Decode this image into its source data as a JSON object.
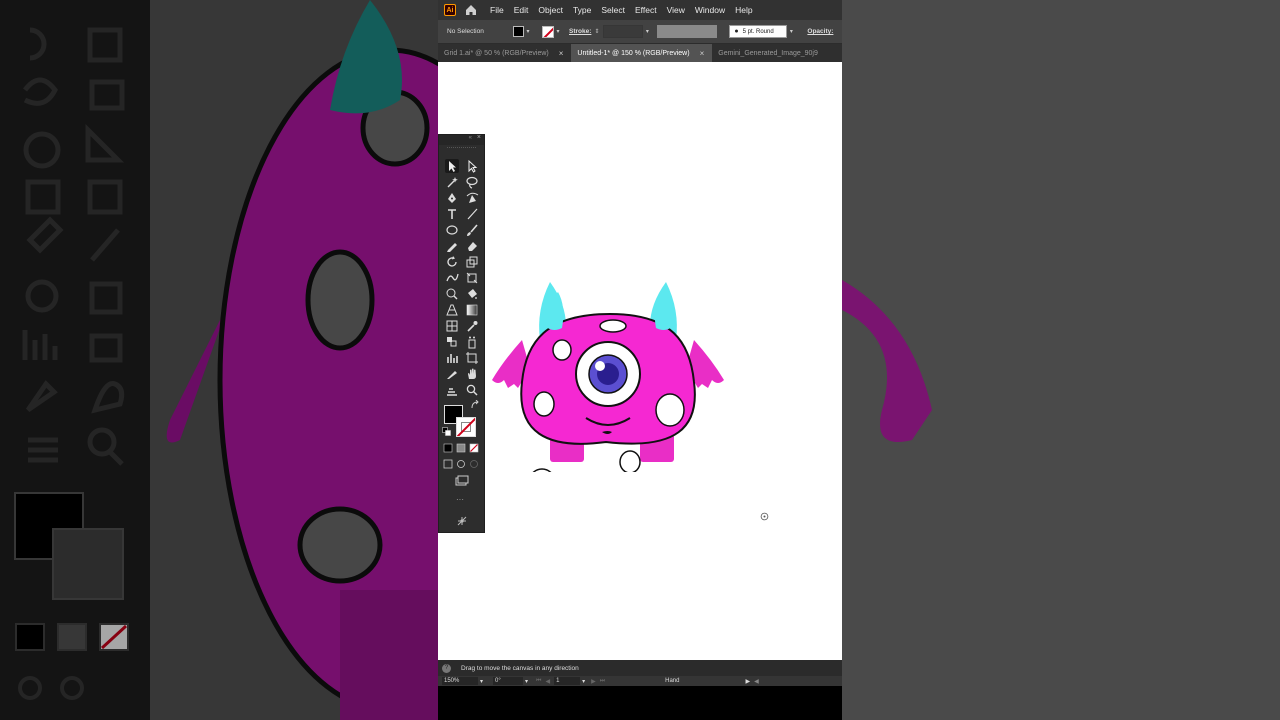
{
  "menubar": {
    "app_logo": "Ai",
    "items": [
      "File",
      "Edit",
      "Object",
      "Type",
      "Select",
      "Effect",
      "View",
      "Window",
      "Help"
    ]
  },
  "controlbar": {
    "selection_status": "No Selection",
    "stroke_label": "Stroke:",
    "brush_size": "5 pt. Round",
    "opacity_label": "Opacity:"
  },
  "tabs": [
    {
      "label": "Grid 1.ai* @ 50 % (RGB/Preview)",
      "close": "×"
    },
    {
      "label": "Untitled-1* @ 150 % (RGB/Preview)",
      "close": "×"
    },
    {
      "label": "Gemini_Generated_Image_90j9"
    }
  ],
  "statusbar": {
    "help_glyph": "?",
    "message": "Drag to move the canvas in any direction"
  },
  "bottombar": {
    "zoom": "150%",
    "rotation": "0°",
    "artboard": "1",
    "tool_name": "Hand"
  },
  "colors": {
    "monster_body": "#f528d2",
    "monster_horns": "#5ce8ef",
    "monster_legs": "#e92ec6",
    "iris": "#5b4fd1",
    "fill_swatch": "#000000",
    "stroke_none_slash": "#d0021b"
  },
  "toolbox": {
    "collapse_glyph": "«",
    "close_glyph": "×",
    "more_glyph": "···"
  }
}
